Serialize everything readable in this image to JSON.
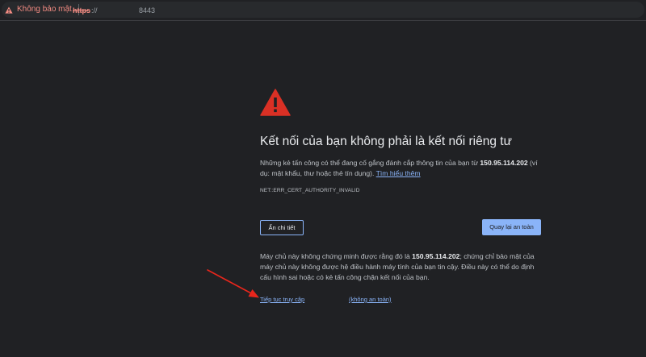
{
  "address_bar": {
    "security_label": "Không bảo mật",
    "scheme": "https",
    "separator": "://",
    "port": "8443"
  },
  "interstitial": {
    "heading": "Kết nối của bạn không phải là kết nối riêng tư",
    "explain_prefix": "Những kẻ tấn công có thể đang cố gắng đánh cắp thông tin của bạn từ ",
    "host_ip": "150.95.114.202",
    "explain_suffix": " (ví dụ: mật khẩu, thư hoặc thẻ tín dụng).",
    "learn_more": "Tìm hiểu thêm",
    "error_code": "NET::ERR_CERT_AUTHORITY_INVALID",
    "details_button": "Ẩn chi tiết",
    "back_button": "Quay lại an toàn",
    "details_prefix": "Máy chủ này không chứng minh được rằng đó là ",
    "details_ip": "150.95.114.202",
    "details_suffix": "; chứng chỉ bảo mật của máy chủ này không được hệ điều hành máy tính của bạn tin cậy. Điều này có thể do định cấu hình sai hoặc có kẻ tấn công chặn kết nối của bạn.",
    "proceed_link": "Tiếp tục truy cập",
    "unsafe_note": "(không an toàn)"
  },
  "colors": {
    "background": "#202124",
    "warning_red": "#f28b82",
    "icon_red": "#d93025",
    "link_blue": "#8ab4f8",
    "annotation_arrow": "#e8261c"
  },
  "icons": [
    "warning-triangle-icon",
    "error-exclamation-icon",
    "annotation-arrow-icon"
  ]
}
